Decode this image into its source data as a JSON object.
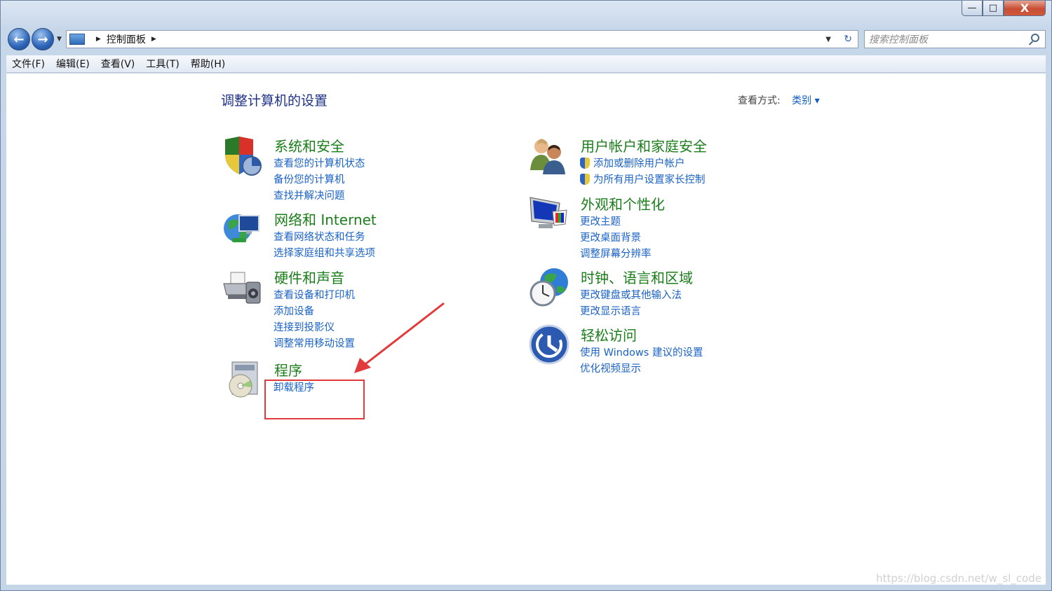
{
  "window": {
    "caption": {
      "min": "—",
      "max": "□",
      "close": "X"
    }
  },
  "nav": {
    "back": "←",
    "forward": "→",
    "dropdown": "▼"
  },
  "address": {
    "path": "控制面板",
    "sep": "▶",
    "dropdown": "▼",
    "refresh": "↻"
  },
  "search": {
    "placeholder": "搜索控制面板"
  },
  "menu": [
    "文件(F)",
    "编辑(E)",
    "查看(V)",
    "工具(T)",
    "帮助(H)"
  ],
  "page": {
    "heading": "调整计算机的设置",
    "viewby_label": "查看方式:",
    "viewby_value": "类别 ▾"
  },
  "categories": [
    {
      "title": "系统和安全",
      "icon": "shield-pie-icon",
      "links": [
        "查看您的计算机状态",
        "备份您的计算机",
        "查找并解决问题"
      ]
    },
    {
      "title": "网络和 Internet",
      "icon": "globe-network-icon",
      "links": [
        "查看网络状态和任务",
        "选择家庭组和共享选项"
      ]
    },
    {
      "title": "硬件和声音",
      "icon": "printer-icon",
      "links": [
        "查看设备和打印机",
        "添加设备",
        "连接到投影仪",
        "调整常用移动设置"
      ]
    },
    {
      "title": "程序",
      "icon": "programs-disc-icon",
      "links": [
        "卸载程序"
      ]
    },
    {
      "title": "用户帐户和家庭安全",
      "icon": "users-icon",
      "links": [
        "添加或删除用户帐户",
        "为所有用户设置家长控制"
      ]
    },
    {
      "title": "外观和个性化",
      "icon": "monitor-palette-icon",
      "links": [
        "更改主题",
        "更改桌面背景",
        "调整屏幕分辨率"
      ]
    },
    {
      "title": "时钟、语言和区域",
      "icon": "clock-globe-icon",
      "links": [
        "更改键盘或其他输入法",
        "更改显示语言"
      ]
    },
    {
      "title": "轻松访问",
      "icon": "ease-of-access-icon",
      "links": [
        "使用 Windows 建议的设置",
        "优化视频显示"
      ]
    }
  ],
  "watermark": "https://blog.csdn.net/w_sl_code",
  "colors": {
    "title_green": "#1b7e1b",
    "link_blue": "#1a62c6",
    "heading_blue": "#1e3287",
    "annotation_red": "#e23a3a"
  }
}
